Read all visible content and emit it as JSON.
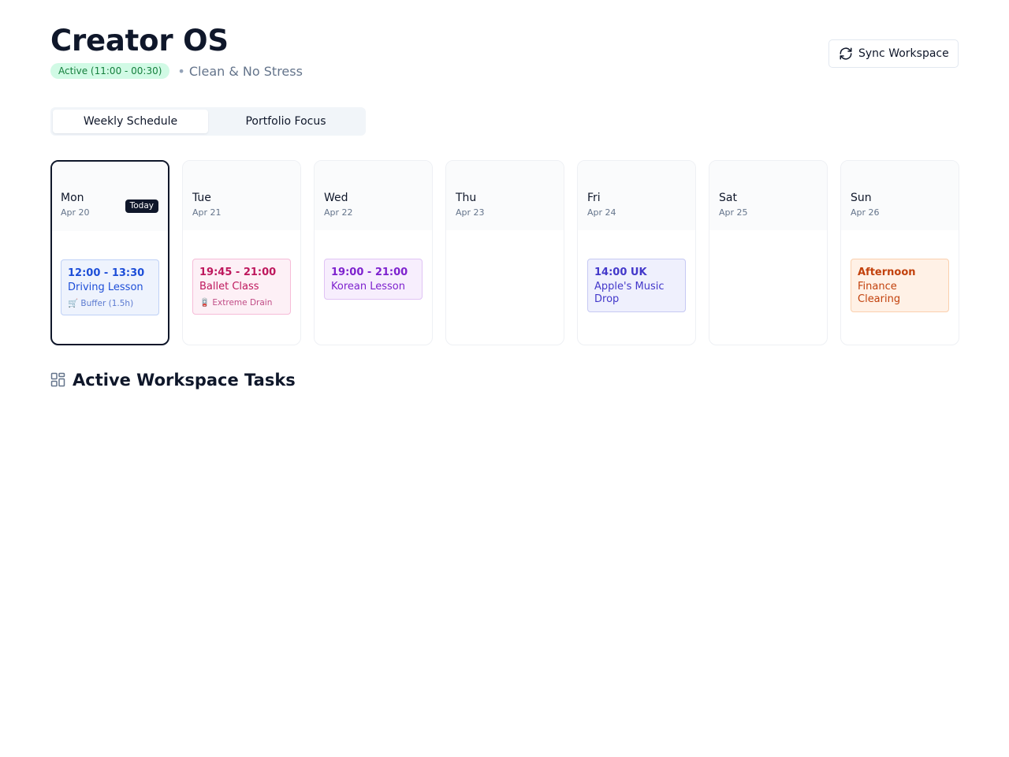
{
  "header": {
    "title": "Creator OS",
    "status_badge": "Active (11:00 - 00:30)",
    "separator": "•",
    "mood": "Clean & No Stress"
  },
  "sync_button": {
    "label": "Sync Workspace",
    "icon": "refresh-icon"
  },
  "tabs": [
    {
      "label": "Weekly Schedule",
      "active": true
    },
    {
      "label": "Portfolio Focus",
      "active": false
    }
  ],
  "days": [
    {
      "name": "Mon",
      "date": "Apr 20",
      "today_badge": "Today",
      "event": {
        "time": "12:00 - 13:30",
        "title": "Driving Lesson",
        "note": "🛒 Buffer (1.5h)"
      }
    },
    {
      "name": "Tue",
      "date": "Apr 21",
      "event": {
        "time": "19:45 - 21:00",
        "title": "Ballet Class",
        "note": "🪫 Extreme Drain"
      }
    },
    {
      "name": "Wed",
      "date": "Apr 22",
      "event": {
        "time": "19:00 - 21:00",
        "title": "Korean Lesson"
      }
    },
    {
      "name": "Thu",
      "date": "Apr 23"
    },
    {
      "name": "Fri",
      "date": "Apr 24",
      "event": {
        "time": "14:00 UK",
        "title": "Apple's Music Drop"
      }
    },
    {
      "name": "Sat",
      "date": "Apr 25"
    },
    {
      "name": "Sun",
      "date": "Apr 26",
      "event": {
        "time": "Afternoon",
        "title": "Finance Clearing"
      }
    }
  ],
  "section": {
    "title": "Active Workspace Tasks",
    "icon": "grid-icon"
  },
  "colors": {
    "primary": "#0f172a",
    "active_badge_bg": "#d1fae5",
    "active_badge_text": "#15803d",
    "event_blue": "#1d4ed8",
    "event_pink": "#be185d",
    "event_purple": "#7e22ce",
    "event_indigo": "#4338ca",
    "event_orange": "#c2410c"
  }
}
